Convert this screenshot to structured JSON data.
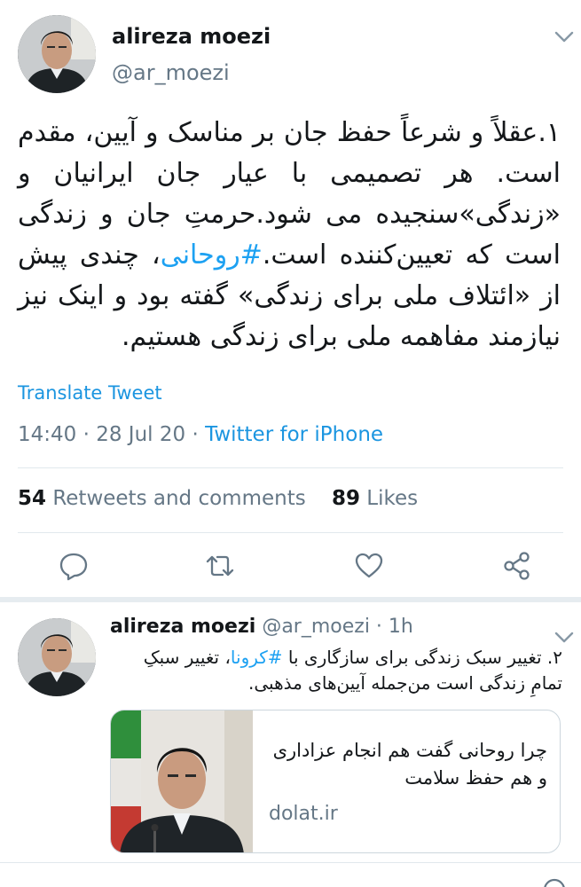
{
  "main_tweet": {
    "author_name": "alireza moezi",
    "handle": "@ar_moezi",
    "body_before_hashtag": "۱.عقلاً و شرعاً حفظ جان بر مناسک و آیین، مقدم است. هر تصمیمی با عیار جان ایرانیان و «زندگی»سنجیده می شود.حرمتِ جان و زندگی است که تعیین‌کننده است.",
    "hashtag": "#روحانی",
    "body_after_hashtag": "، چندی پیش از «ائتلاف ملی برای زندگی» گفته بود و اینک نیز نیازمند مفاهمه ملی برای زندگی هستیم.",
    "translate_label": "Translate Tweet",
    "time": "14:40",
    "date": "28 Jul 20",
    "meta_separator": " · ",
    "source": "Twitter for iPhone",
    "retweets_count": "54",
    "retweets_label": "Retweets and comments",
    "likes_count": "89",
    "likes_label": "Likes"
  },
  "second_tweet": {
    "author_name": "alireza moezi",
    "handle": "@ar_moezi",
    "time_ago": " · 1h",
    "body_before_hashtag": "۲. تغییر سبک زندگی برای سازگاری با ",
    "hashtag": "#کرونا",
    "body_after_hashtag": "، تغییر سبکِ تمامِ زندگی است من‌جمله آیین‌های مذهبی.",
    "card": {
      "title": "چرا روحانی گفت هم انجام عزاداری و هم حفظ سلامت",
      "domain": "dolat.ir"
    }
  },
  "colors": {
    "link_blue": "#1b95e0",
    "hashtag_blue": "#1da1f2",
    "secondary_gray": "#657786",
    "divider": "#e1e8ed"
  },
  "icons": {
    "reply": "reply-icon",
    "retweet": "retweet-icon",
    "like": "heart-icon",
    "share": "share-icon",
    "caret": "chevron-down-icon"
  }
}
